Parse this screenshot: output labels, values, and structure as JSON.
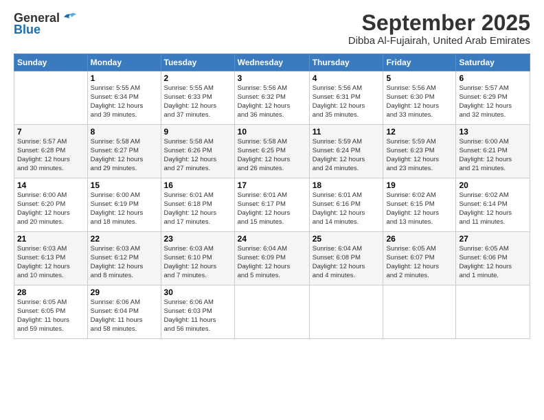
{
  "header": {
    "logo_general": "General",
    "logo_blue": "Blue",
    "title": "September 2025",
    "subtitle": "Dibba Al-Fujairah, United Arab Emirates"
  },
  "days_of_week": [
    "Sunday",
    "Monday",
    "Tuesday",
    "Wednesday",
    "Thursday",
    "Friday",
    "Saturday"
  ],
  "weeks": [
    [
      {
        "day": "",
        "content": ""
      },
      {
        "day": "1",
        "content": "Sunrise: 5:55 AM\nSunset: 6:34 PM\nDaylight: 12 hours\nand 39 minutes."
      },
      {
        "day": "2",
        "content": "Sunrise: 5:55 AM\nSunset: 6:33 PM\nDaylight: 12 hours\nand 37 minutes."
      },
      {
        "day": "3",
        "content": "Sunrise: 5:56 AM\nSunset: 6:32 PM\nDaylight: 12 hours\nand 36 minutes."
      },
      {
        "day": "4",
        "content": "Sunrise: 5:56 AM\nSunset: 6:31 PM\nDaylight: 12 hours\nand 35 minutes."
      },
      {
        "day": "5",
        "content": "Sunrise: 5:56 AM\nSunset: 6:30 PM\nDaylight: 12 hours\nand 33 minutes."
      },
      {
        "day": "6",
        "content": "Sunrise: 5:57 AM\nSunset: 6:29 PM\nDaylight: 12 hours\nand 32 minutes."
      }
    ],
    [
      {
        "day": "7",
        "content": "Sunrise: 5:57 AM\nSunset: 6:28 PM\nDaylight: 12 hours\nand 30 minutes."
      },
      {
        "day": "8",
        "content": "Sunrise: 5:58 AM\nSunset: 6:27 PM\nDaylight: 12 hours\nand 29 minutes."
      },
      {
        "day": "9",
        "content": "Sunrise: 5:58 AM\nSunset: 6:26 PM\nDaylight: 12 hours\nand 27 minutes."
      },
      {
        "day": "10",
        "content": "Sunrise: 5:58 AM\nSunset: 6:25 PM\nDaylight: 12 hours\nand 26 minutes."
      },
      {
        "day": "11",
        "content": "Sunrise: 5:59 AM\nSunset: 6:24 PM\nDaylight: 12 hours\nand 24 minutes."
      },
      {
        "day": "12",
        "content": "Sunrise: 5:59 AM\nSunset: 6:23 PM\nDaylight: 12 hours\nand 23 minutes."
      },
      {
        "day": "13",
        "content": "Sunrise: 6:00 AM\nSunset: 6:21 PM\nDaylight: 12 hours\nand 21 minutes."
      }
    ],
    [
      {
        "day": "14",
        "content": "Sunrise: 6:00 AM\nSunset: 6:20 PM\nDaylight: 12 hours\nand 20 minutes."
      },
      {
        "day": "15",
        "content": "Sunrise: 6:00 AM\nSunset: 6:19 PM\nDaylight: 12 hours\nand 18 minutes."
      },
      {
        "day": "16",
        "content": "Sunrise: 6:01 AM\nSunset: 6:18 PM\nDaylight: 12 hours\nand 17 minutes."
      },
      {
        "day": "17",
        "content": "Sunrise: 6:01 AM\nSunset: 6:17 PM\nDaylight: 12 hours\nand 15 minutes."
      },
      {
        "day": "18",
        "content": "Sunrise: 6:01 AM\nSunset: 6:16 PM\nDaylight: 12 hours\nand 14 minutes."
      },
      {
        "day": "19",
        "content": "Sunrise: 6:02 AM\nSunset: 6:15 PM\nDaylight: 12 hours\nand 13 minutes."
      },
      {
        "day": "20",
        "content": "Sunrise: 6:02 AM\nSunset: 6:14 PM\nDaylight: 12 hours\nand 11 minutes."
      }
    ],
    [
      {
        "day": "21",
        "content": "Sunrise: 6:03 AM\nSunset: 6:13 PM\nDaylight: 12 hours\nand 10 minutes."
      },
      {
        "day": "22",
        "content": "Sunrise: 6:03 AM\nSunset: 6:12 PM\nDaylight: 12 hours\nand 8 minutes."
      },
      {
        "day": "23",
        "content": "Sunrise: 6:03 AM\nSunset: 6:10 PM\nDaylight: 12 hours\nand 7 minutes."
      },
      {
        "day": "24",
        "content": "Sunrise: 6:04 AM\nSunset: 6:09 PM\nDaylight: 12 hours\nand 5 minutes."
      },
      {
        "day": "25",
        "content": "Sunrise: 6:04 AM\nSunset: 6:08 PM\nDaylight: 12 hours\nand 4 minutes."
      },
      {
        "day": "26",
        "content": "Sunrise: 6:05 AM\nSunset: 6:07 PM\nDaylight: 12 hours\nand 2 minutes."
      },
      {
        "day": "27",
        "content": "Sunrise: 6:05 AM\nSunset: 6:06 PM\nDaylight: 12 hours\nand 1 minute."
      }
    ],
    [
      {
        "day": "28",
        "content": "Sunrise: 6:05 AM\nSunset: 6:05 PM\nDaylight: 11 hours\nand 59 minutes."
      },
      {
        "day": "29",
        "content": "Sunrise: 6:06 AM\nSunset: 6:04 PM\nDaylight: 11 hours\nand 58 minutes."
      },
      {
        "day": "30",
        "content": "Sunrise: 6:06 AM\nSunset: 6:03 PM\nDaylight: 11 hours\nand 56 minutes."
      },
      {
        "day": "",
        "content": ""
      },
      {
        "day": "",
        "content": ""
      },
      {
        "day": "",
        "content": ""
      },
      {
        "day": "",
        "content": ""
      }
    ]
  ]
}
